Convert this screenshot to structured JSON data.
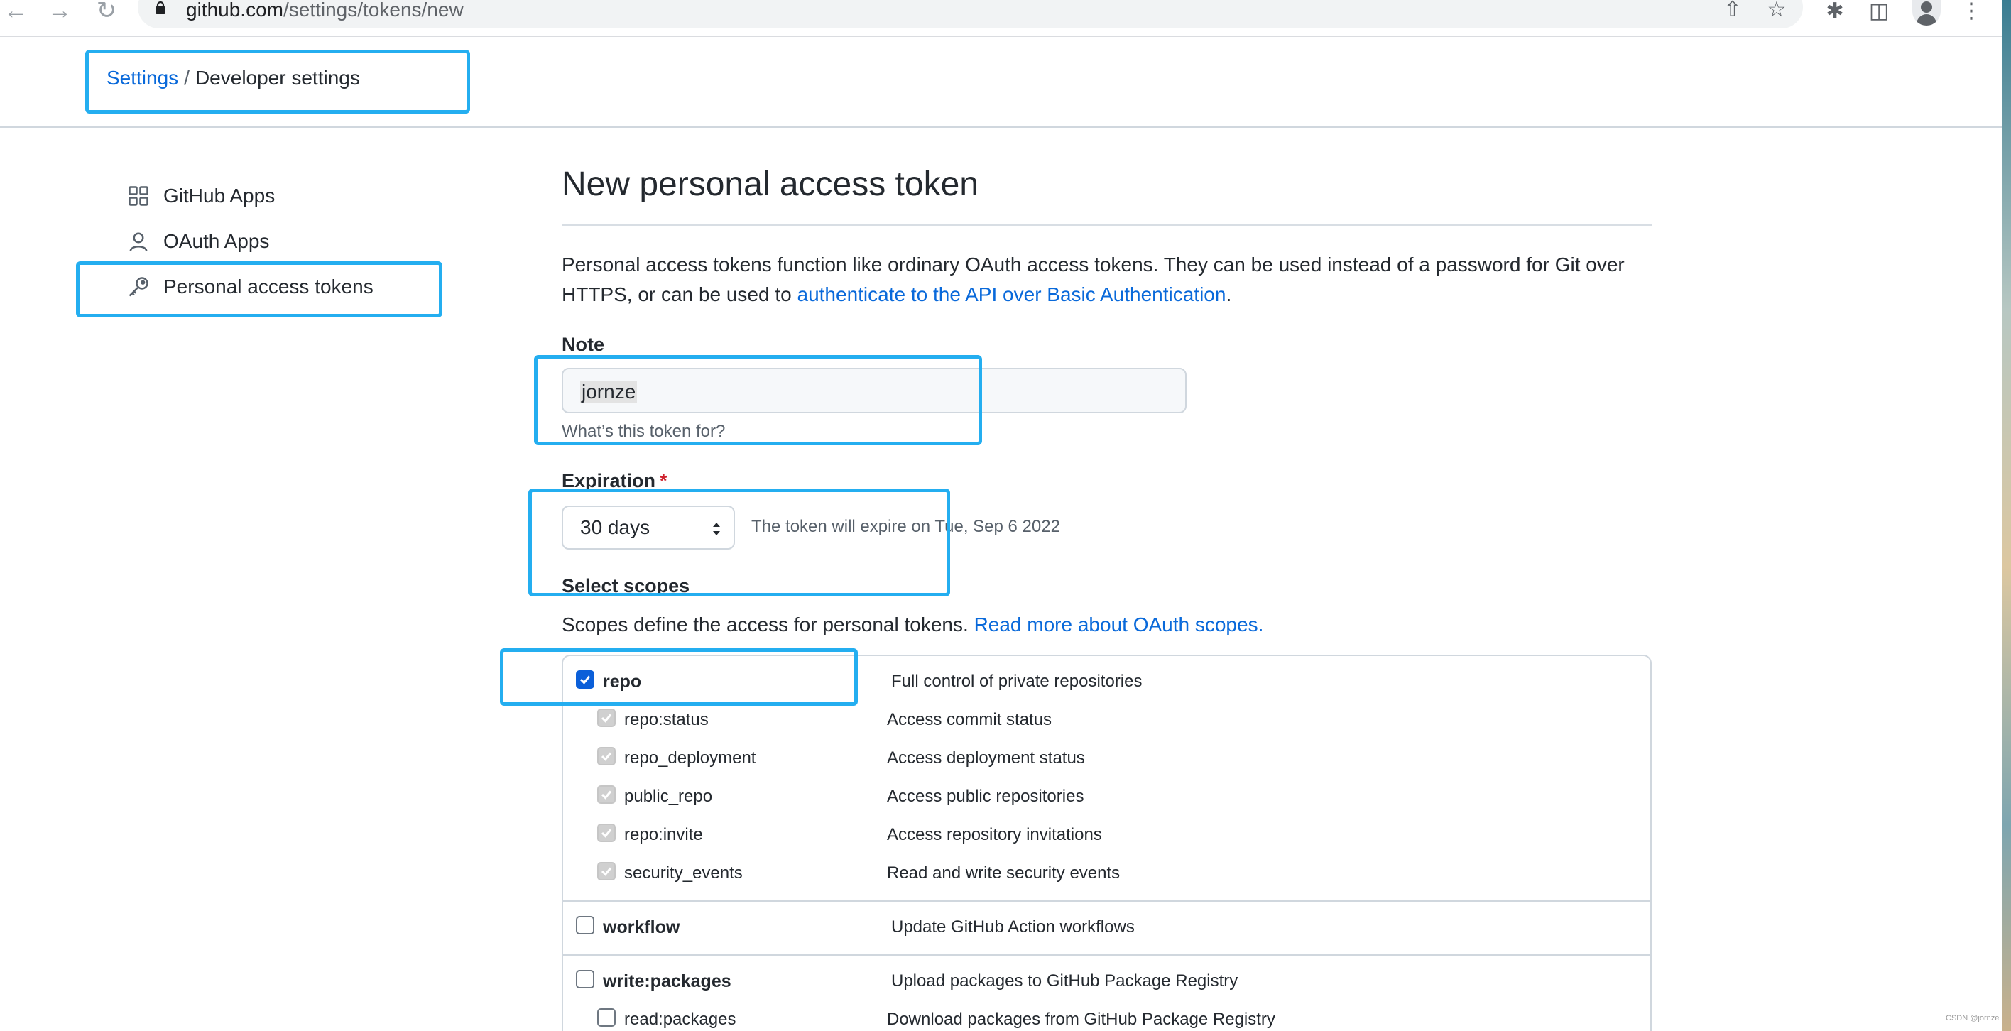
{
  "browser": {
    "url_host": "github.com",
    "url_path": "/settings/tokens/new"
  },
  "breadcrumb": {
    "link": "Settings",
    "separator": "/",
    "current": "Developer settings"
  },
  "sidebar": {
    "items": [
      {
        "label": "GitHub Apps",
        "icon": "apps-icon"
      },
      {
        "label": "OAuth Apps",
        "icon": "person-icon"
      },
      {
        "label": "Personal access tokens",
        "icon": "key-icon"
      }
    ]
  },
  "main": {
    "title": "New personal access token",
    "intro_text": "Personal access tokens function like ordinary OAuth access tokens. They can be used instead of a password for Git over HTTPS, or can be used to ",
    "intro_link": "authenticate to the API over Basic Authentication",
    "intro_end": "."
  },
  "note": {
    "label": "Note",
    "value": "jornze",
    "help": "What’s this token for?"
  },
  "expiration": {
    "label": "Expiration",
    "required_mark": "*",
    "selected": "30 days",
    "message": "The token will expire on Tue, Sep 6 2022"
  },
  "scopes": {
    "heading": "Select scopes",
    "description": "Scopes define the access for personal tokens. ",
    "link": "Read more about OAuth scopes.",
    "groups": [
      {
        "name": "repo",
        "description": "Full control of private repositories",
        "checked": true,
        "children": [
          {
            "name": "repo:status",
            "description": "Access commit status",
            "checked": true
          },
          {
            "name": "repo_deployment",
            "description": "Access deployment status",
            "checked": true
          },
          {
            "name": "public_repo",
            "description": "Access public repositories",
            "checked": true
          },
          {
            "name": "repo:invite",
            "description": "Access repository invitations",
            "checked": true
          },
          {
            "name": "security_events",
            "description": "Read and write security events",
            "checked": true
          }
        ]
      },
      {
        "name": "workflow",
        "description": "Update GitHub Action workflows",
        "checked": false,
        "children": []
      },
      {
        "name": "write:packages",
        "description": "Upload packages to GitHub Package Registry",
        "checked": false,
        "children": [
          {
            "name": "read:packages",
            "description": "Download packages from GitHub Package Registry",
            "checked": false
          }
        ]
      }
    ]
  },
  "watermark": "CSDN @jornze",
  "colors": {
    "link": "#0969da",
    "checkbox": "#0b5fd9",
    "annotation": "#24aef0",
    "required": "#cf222e"
  }
}
